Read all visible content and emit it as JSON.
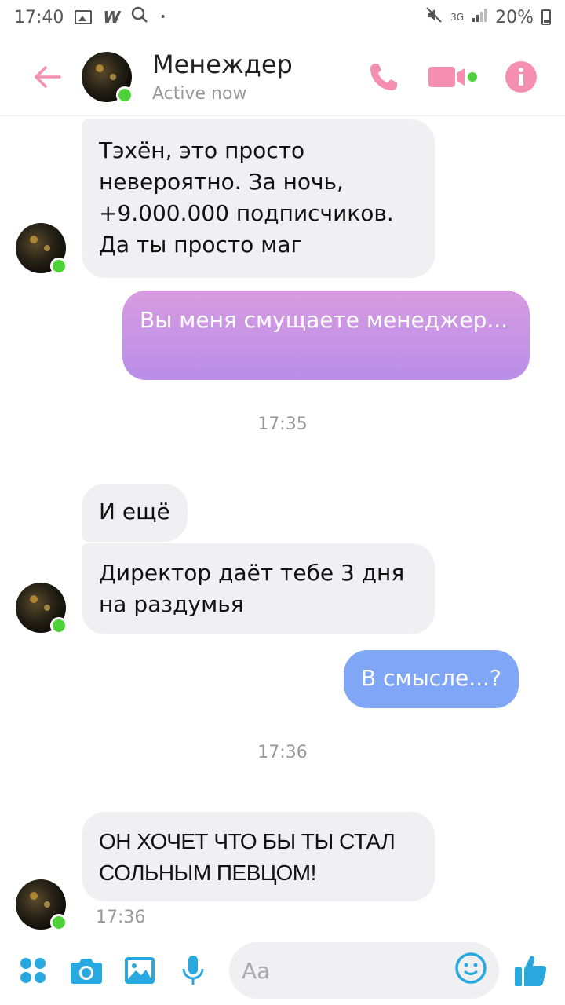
{
  "status_bar": {
    "time": "17:40",
    "network": "3G",
    "battery": "20%",
    "icons": [
      "image-icon",
      "w-icon",
      "search-icon",
      "dot-icon",
      "mute-icon",
      "signal-icon",
      "battery-icon"
    ]
  },
  "header": {
    "contact_name": "Менеждер",
    "status": "Active now",
    "accent_color": "#f48fb1"
  },
  "messages": [
    {
      "direction": "in",
      "text": "Тэхён, это просто невероятно. За ночь, +9.000.000 подписчиков. Да ты просто маг"
    },
    {
      "direction": "out",
      "text": "Вы меня смущаете менеджер..."
    },
    {
      "type": "timestamp",
      "text": "17:35"
    },
    {
      "direction": "in",
      "text": "И ещё"
    },
    {
      "direction": "in",
      "text": "Директор даёт тебе 3 дня на раздумья"
    },
    {
      "direction": "out",
      "text": "В смысле...?"
    },
    {
      "type": "timestamp",
      "text": "17:36"
    },
    {
      "direction": "in",
      "text": "ОН ХОЧЕТ ЧТО БЫ ТЫ СТАЛ СОЛЬНЫМ ПЕВЦОМ!"
    },
    {
      "type": "sent_time",
      "text": "17:36"
    }
  ],
  "composer": {
    "placeholder": "Aa"
  },
  "colors": {
    "bubble_in": "#f0f0f2",
    "bubble_out_purple_top": "#d79be0",
    "bubble_out_purple_bottom": "#b98ee8",
    "bubble_out_blue": "#7fa7f5",
    "composer_icon": "#29a8e0",
    "online": "#4cd137"
  }
}
